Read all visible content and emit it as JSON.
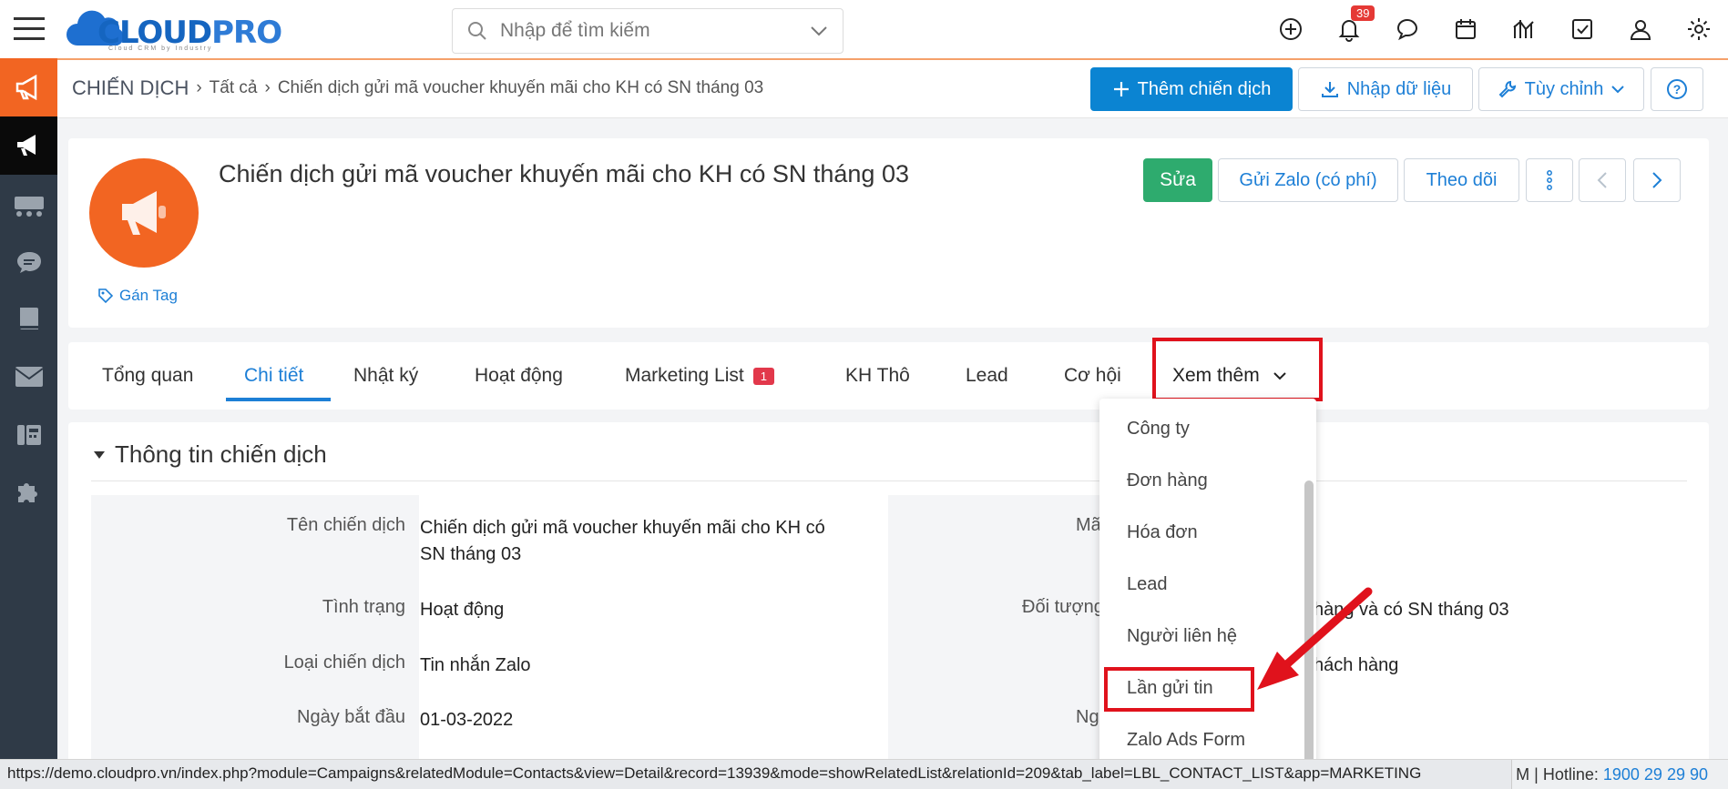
{
  "app": {
    "logo_text": "CLOUD",
    "logo_text2": "PRO",
    "logo_sub": "Cloud CRM by Industry"
  },
  "search": {
    "placeholder": "Nhập để tìm kiếm"
  },
  "notifications": {
    "count": "39"
  },
  "breadcrumb": {
    "root": "CHIẾN DỊCH",
    "all": "Tất cả",
    "current": "Chiến dịch gửi mã voucher khuyến mãi cho KH có SN tháng 03"
  },
  "toolbar": {
    "add_label": "Thêm chiến dịch",
    "import_label": "Nhập dữ liệu",
    "customize_label": "Tùy chỉnh"
  },
  "record": {
    "title": "Chiến dịch gửi mã voucher khuyến mãi cho KH có SN tháng 03",
    "tag_label": "Gán Tag",
    "edit_label": "Sửa",
    "zalo_label": "Gửi Zalo (có phí)",
    "follow_label": "Theo dõi"
  },
  "tabs": [
    {
      "label": "Tổng quan"
    },
    {
      "label": "Chi tiết"
    },
    {
      "label": "Nhật ký"
    },
    {
      "label": "Hoạt động"
    },
    {
      "label": "Marketing List",
      "badge": "1"
    },
    {
      "label": "KH Thô"
    },
    {
      "label": "Lead"
    },
    {
      "label": "Cơ hội"
    },
    {
      "label": "Xem thêm"
    }
  ],
  "section": {
    "title": "Thông tin chiến dịch"
  },
  "fields_left": [
    {
      "label": "Tên chiến dịch",
      "value": "Chiến dịch gửi mã voucher khuyến mãi cho KH có SN tháng 03"
    },
    {
      "label": "Tình trạng",
      "value": "Hoạt động"
    },
    {
      "label": "Loại chiến dịch",
      "value": "Tin nhắn Zalo"
    },
    {
      "label": "Ngày bắt đầu",
      "value": "01-03-2022"
    }
  ],
  "fields_right": [
    {
      "label": "Mã",
      "value": ""
    },
    {
      "label": "Đối tượng",
      "value": "hàng và có SN tháng 03"
    },
    {
      "label": "",
      "value": "hách hàng"
    },
    {
      "label": "Ng",
      "value": ""
    }
  ],
  "dropdown": {
    "items": [
      "Công ty",
      "Đơn hàng",
      "Hóa đơn",
      "Lead",
      "Người liên hệ",
      "Lần gửi tin",
      "Zalo Ads Form"
    ]
  },
  "status": {
    "url": "https://demo.cloudpro.vn/index.php?module=Campaigns&relatedModule=Contacts&view=Detail&record=13939&mode=showRelatedList&relationId=209&tab_label=LBL_CONTACT_LIST&app=MARKETING",
    "hotline_label": "M | Hotline:",
    "hotline_number": "1900 29 29 90"
  },
  "colors": {
    "accent": "#1d7fd6",
    "brand_orange": "#f26522",
    "green": "#2eab6e",
    "highlight_red": "#e0121c"
  }
}
